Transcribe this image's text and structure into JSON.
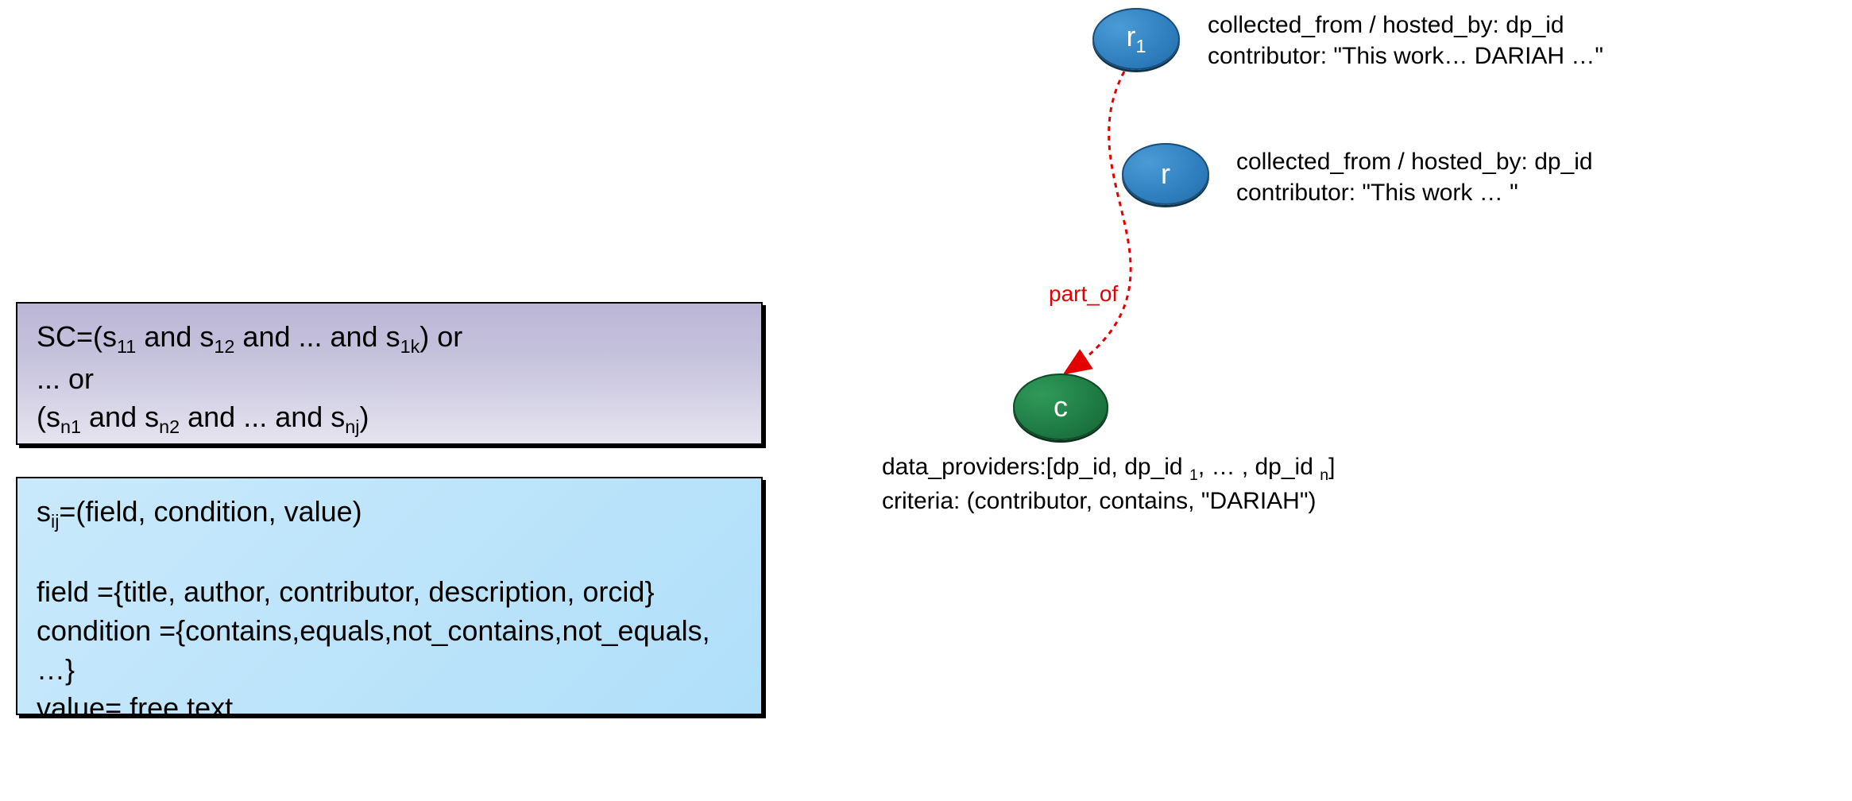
{
  "panels": {
    "sc": {
      "line1_prefix": "SC=(s",
      "line1_sub1": "11",
      "line1_mid1": " and s",
      "line1_sub2": "12",
      "line1_mid2": " and ... and s",
      "line1_sub3": "1k",
      "line1_suffix": ")  or",
      "line2": "... or",
      "line3_prefix": "(s",
      "line3_sub1": "n1",
      "line3_mid1": " and s",
      "line3_sub2": "n2",
      "line3_mid2": " and ... and s",
      "line3_sub3": "nj",
      "line3_suffix": ")"
    },
    "def": {
      "l1_prefix": "s",
      "l1_sub": "ij",
      "l1_rest": "=(field, condition, value)",
      "l3": "field ={title, author, contributor, description, orcid}",
      "l4": "condition ={contains,equals,not_contains,not_equals, …}",
      "l5": "value= free text"
    }
  },
  "nodes": {
    "r1_label_main": "r",
    "r1_label_sub": "1",
    "r_label": "r",
    "c_label": "c"
  },
  "annotations": {
    "r1_line1": "collected_from / hosted_by: dp_id",
    "r1_line2": "contributor: \"This work… DARIAH …\"",
    "r_line1": "collected_from / hosted_by: dp_id",
    "r_line2": "contributor: \"This work … \"",
    "c_line1_pre": "data_providers:[dp_id, dp_id ",
    "c_line1_sub1": "1",
    "c_line1_mid": ", … , dp_id ",
    "c_line1_sub2": "n",
    "c_line1_post": "]",
    "c_line2": "criteria: (contributor, contains, \"DARIAH\")"
  },
  "edges": {
    "partof": "part_of"
  }
}
